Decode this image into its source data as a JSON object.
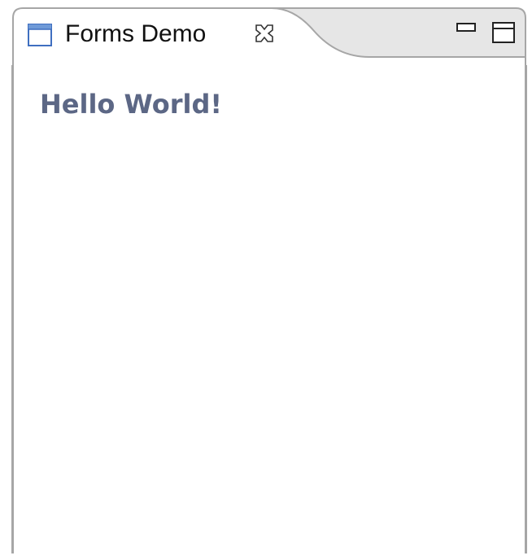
{
  "view": {
    "tab": {
      "icon": "view-window-icon",
      "title": "Forms Demo",
      "close_icon": "close-icon"
    },
    "toolbar": {
      "minimize_icon": "minimize-icon",
      "maximize_icon": "maximize-icon"
    }
  },
  "form": {
    "title": "Hello World!"
  },
  "colors": {
    "form_title": "#5c6785",
    "icon_blue": "#3f6fc0",
    "tab_bar_bg": "#e6e6e6",
    "border": "#a6a6a6"
  }
}
